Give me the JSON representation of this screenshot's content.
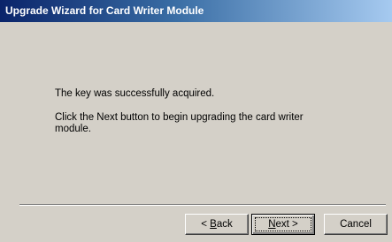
{
  "window": {
    "title": "Upgrade Wizard for Card Writer Module"
  },
  "content": {
    "message_line1": "The key was successfully acquired.",
    "message_line2": "Click the Next button to begin upgrading the card writer module."
  },
  "buttons": {
    "back": {
      "prefix": "< ",
      "mnemonic": "B",
      "rest": "ack"
    },
    "next": {
      "mnemonic": "N",
      "rest": "ext >"
    },
    "cancel": "Cancel"
  },
  "colors": {
    "title_start": "#0a246a",
    "title_end": "#a6caf0",
    "face": "#d4d0c8"
  }
}
